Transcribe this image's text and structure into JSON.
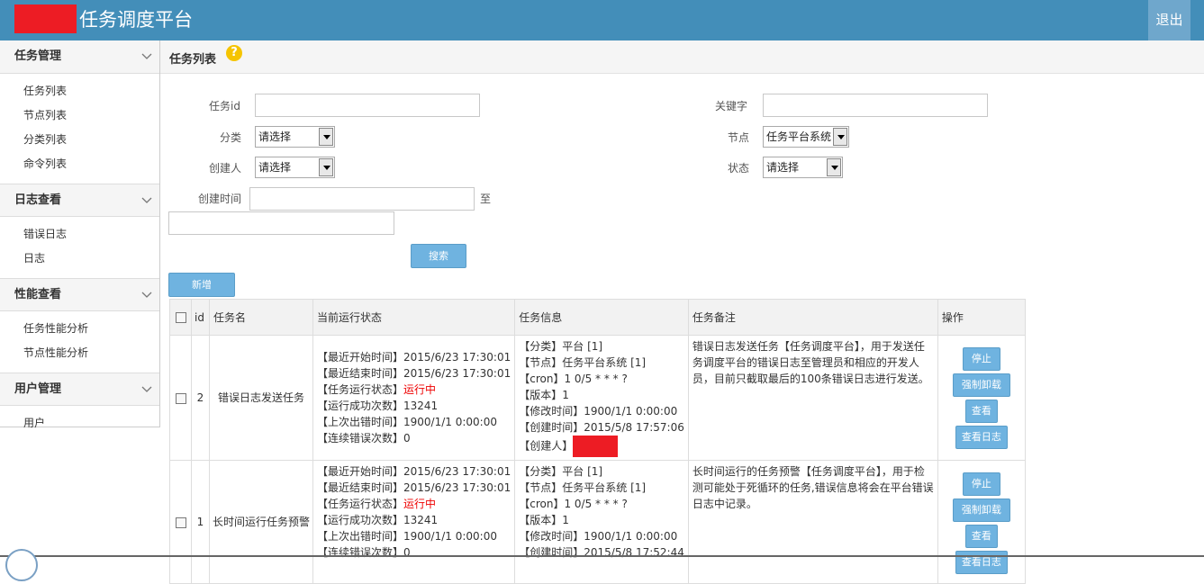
{
  "header": {
    "app_title": "任务调度平台",
    "logout_label": "退出",
    "brand_color": "#438eb9"
  },
  "sidebar": {
    "groups": [
      {
        "title": "任务管理",
        "items": [
          "任务列表",
          "节点列表",
          "分类列表",
          "命令列表"
        ]
      },
      {
        "title": "日志查看",
        "items": [
          "错误日志",
          "日志"
        ]
      },
      {
        "title": "性能查看",
        "items": [
          "任务性能分析",
          "节点性能分析"
        ]
      },
      {
        "title": "用户管理",
        "items": [
          "用户"
        ]
      }
    ]
  },
  "page": {
    "title": "任务列表",
    "help_icon": "question-icon"
  },
  "filters": {
    "task_id_label": "任务id",
    "keyword_label": "关键字",
    "category_label": "分类",
    "category_value": "请选择",
    "node_label": "节点",
    "node_value": "任务平台系统",
    "creator_label": "创建人",
    "creator_value": "请选择",
    "status_label": "状态",
    "status_value": "请选择",
    "created_time_label": "创建时间",
    "to_label": "至",
    "search_label": "搜索",
    "add_label": "新增"
  },
  "table": {
    "headers": [
      "id",
      "任务名",
      "当前运行状态",
      "任务信息",
      "任务备注",
      "操作"
    ],
    "rows": [
      {
        "id": "2",
        "name": "错误日志发送任务",
        "status": {
          "last_start": "【最近开始时间】2015/6/23 17:30:01",
          "last_end": "【最近结束时间】2015/6/23 17:30:01",
          "run_state_label": "【任务运行状态】",
          "run_state": "运行中",
          "success_count": "【运行成功次数】13241",
          "last_error": "【上次出错时间】1900/1/1 0:00:00",
          "consecutive_errors": "【连续错误次数】0"
        },
        "info": {
          "category": "【分类】平台 [1]",
          "node": "【节点】任务平台系统 [1]",
          "cron": "【cron】1 0/5 * * * ?",
          "version": "【版本】1",
          "modified": "【修改时间】1900/1/1 0:00:00",
          "created": "【创建时间】2015/5/8 17:57:06",
          "creator_label": "【创建人】"
        },
        "note": "错误日志发送任务【任务调度平台】，用于发送任务调度平台的错误日志至管理员和相应的开发人员，目前只截取最后的100条错误日志进行发送。",
        "actions": [
          "停止",
          "强制卸载",
          "查看",
          "查看日志"
        ]
      },
      {
        "id": "1",
        "name": "长时间运行任务预警",
        "status": {
          "last_start": "【最近开始时间】2015/6/23 17:30:01",
          "last_end": "【最近结束时间】2015/6/23 17:30:01",
          "run_state_label": "【任务运行状态】",
          "run_state": "运行中",
          "success_count": "【运行成功次数】13241",
          "last_error": "【上次出错时间】1900/1/1 0:00:00",
          "consecutive_errors": "【连续错误次数】0"
        },
        "info": {
          "category": "【分类】平台 [1]",
          "node": "【节点】任务平台系统 [1]",
          "cron": "【cron】1 0/5 * * * ?",
          "version": "【版本】1",
          "modified": "【修改时间】1900/1/1 0:00:00",
          "created": "【创建时间】2015/5/8 17:52:44"
        },
        "note": "长时间运行的任务预警【任务调度平台】，用于检测可能处于死循环的任务,错误信息将会在平台错误日志中记录。",
        "actions": [
          "停止",
          "强制卸载",
          "查看",
          "查看日志"
        ]
      }
    ]
  }
}
